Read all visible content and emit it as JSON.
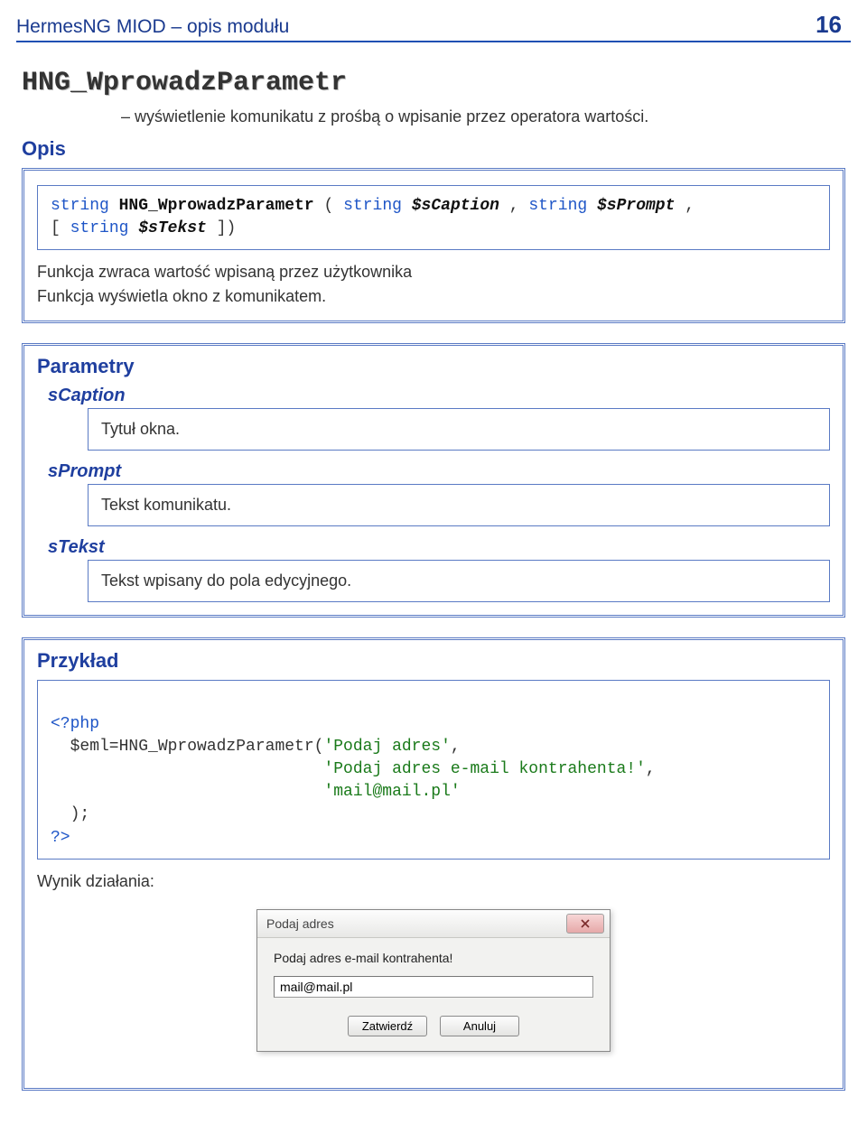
{
  "header": {
    "title": "HermesNG MIOD – opis modułu",
    "page": "16"
  },
  "func": {
    "name": "HNG_WprowadzParametr",
    "subtitle": "– wyświetlenie komunikatu z prośbą o wpisanie przez operatora wartości."
  },
  "opis": {
    "label": "Opis",
    "signature": {
      "ret": "string",
      "name": "HNG_WprowadzParametr",
      "open": " (",
      "t1": "string ",
      "p1": "$sCaption",
      "c1": ", ",
      "t2": "string ",
      "p2": "$sPrompt",
      "c2": ",",
      "line2_open": "[",
      "t3": "string ",
      "p3": "$sTekst",
      "line2_close": "])"
    },
    "desc1": "Funkcja zwraca wartość wpisaną przez użytkownika",
    "desc2": "Funkcja wyświetla okno z komunikatem."
  },
  "parametry": {
    "label": "Parametry",
    "sCaption": {
      "name": "sCaption",
      "desc": "Tytuł okna."
    },
    "sPrompt": {
      "name": "sPrompt",
      "desc": "Tekst komunikatu."
    },
    "sTekst": {
      "name": "sTekst",
      "desc": "Tekst wpisany do pola edycyjnego."
    }
  },
  "przyklad": {
    "label": "Przykład",
    "code": {
      "l1": "<?php",
      "l2a": "  $eml=HNG_WprowadzParametr(",
      "l2b": "'Podaj adres'",
      "l2c": ",",
      "l3pad": "                            ",
      "l3a": "'Podaj adres e-mail kontrahenta!'",
      "l3b": ",",
      "l4pad": "                            ",
      "l4a": "'mail@mail.pl'",
      "l5": "  );",
      "l6": "?>"
    },
    "result_label": "Wynik działania:"
  },
  "dialog": {
    "title": "Podaj adres",
    "prompt": "Podaj adres e-mail kontrahenta!",
    "value": "mail@mail.pl",
    "ok": "Zatwierdź",
    "cancel": "Anuluj"
  }
}
